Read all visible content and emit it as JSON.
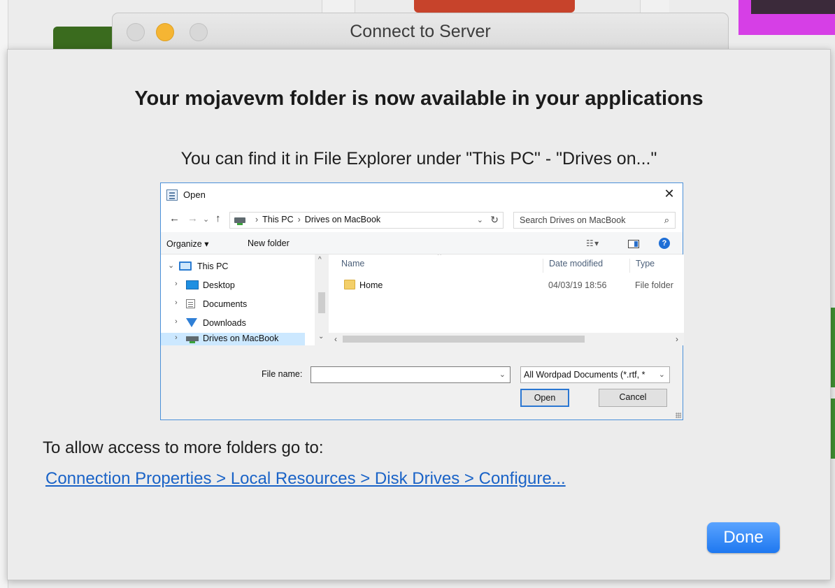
{
  "server_window": {
    "title": "Connect to Server"
  },
  "sheet": {
    "headline": "Your mojavevm folder is now available in your applications",
    "subline": "You can find it in File Explorer under \"This PC\" - \"Drives on...\"",
    "allow_text": "To allow access to more folders go to:",
    "link_text": "Connection Properties > Local Resources > Disk Drives > Configure...",
    "done_label": "Done"
  },
  "open_dialog": {
    "title": "Open",
    "close_glyph": "✕",
    "address": {
      "crumb_1": "This PC",
      "crumb_2": "Drives on MacBook",
      "sep": "›"
    },
    "search_placeholder": "Search Drives on MacBook",
    "toolbar": {
      "organize": "Organize ▾",
      "new_folder": "New folder"
    },
    "nav": {
      "this_pc": "This PC",
      "desktop": "Desktop",
      "documents": "Documents",
      "downloads": "Downloads",
      "drives": "Drives on MacBook"
    },
    "columns": {
      "name": "Name",
      "date": "Date modified",
      "type": "Type"
    },
    "files": [
      {
        "name": "Home",
        "date": "04/03/19 18:56",
        "type": "File folder"
      }
    ],
    "file_name_label": "File name:",
    "file_name_value": "",
    "file_type_value": "All Wordpad Documents (*.rtf, *",
    "open_label": "Open",
    "cancel_label": "Cancel"
  },
  "colors": {
    "accent_blue": "#1e78f0",
    "link_blue": "#1a63c7",
    "minimize_yellow": "#f5b533",
    "window_border": "#4a90d9"
  }
}
